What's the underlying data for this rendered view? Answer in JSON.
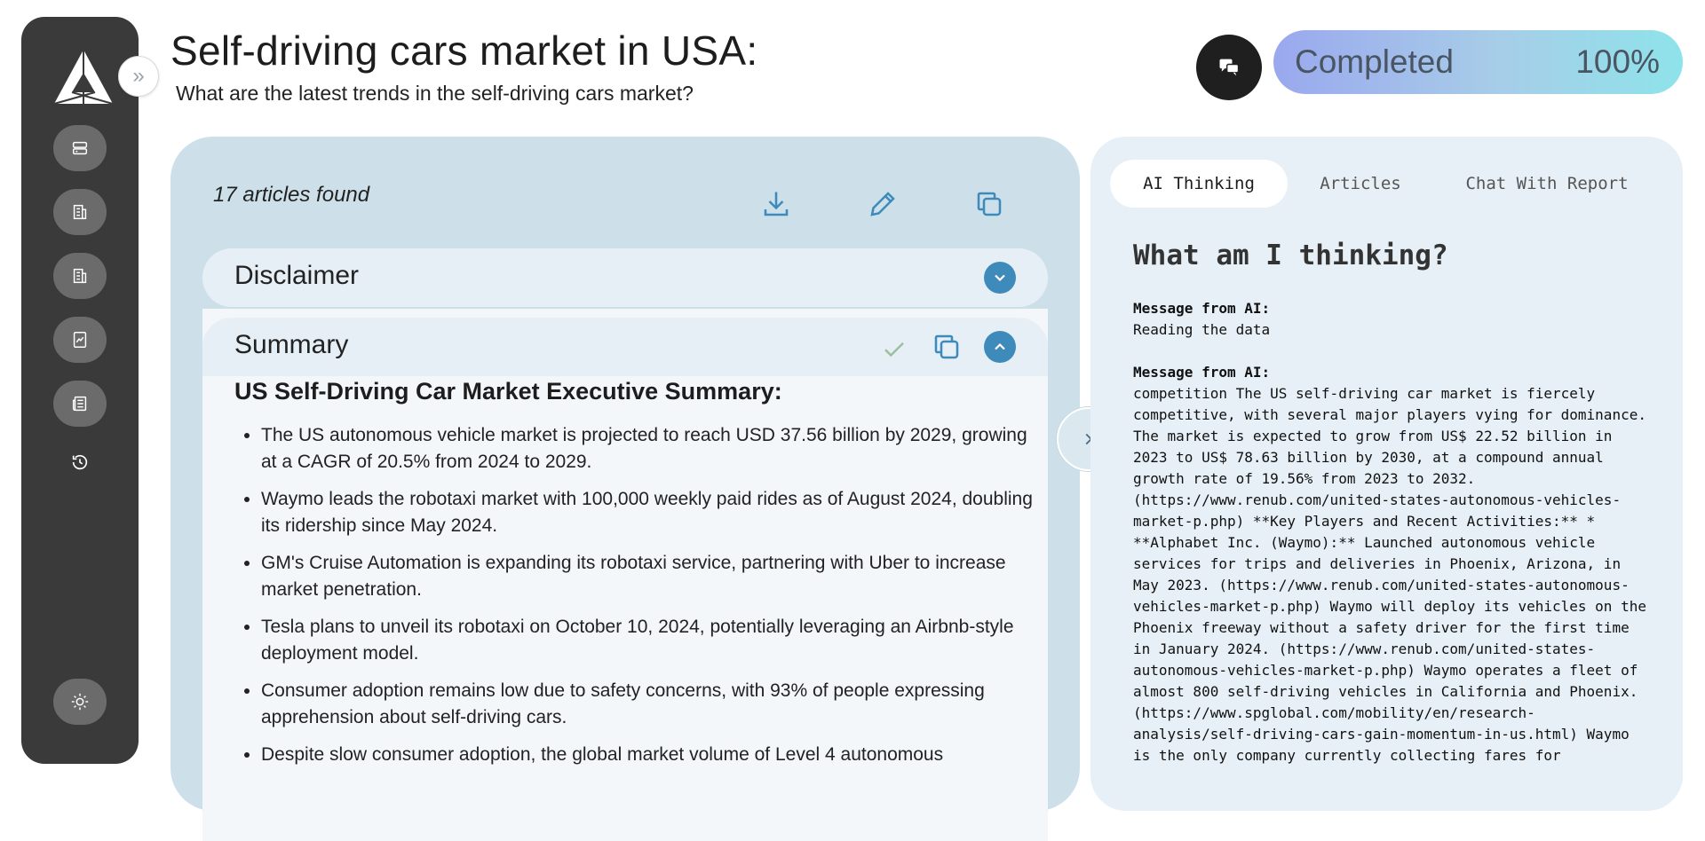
{
  "header": {
    "title": "Self-driving cars market in USA:",
    "subtitle": "What are the latest trends in the self-driving cars market?"
  },
  "status": {
    "label": "Completed",
    "percent": "100%",
    "progress": 1.0
  },
  "sidebar": {
    "items": [
      {
        "icon": "storage-icon"
      },
      {
        "icon": "building-icon"
      },
      {
        "icon": "building-icon"
      },
      {
        "icon": "chart-document-icon"
      },
      {
        "icon": "newspaper-icon"
      },
      {
        "icon": "history-icon"
      }
    ],
    "bottom_icon": "sun-icon"
  },
  "left_panel": {
    "articles_found": "17 articles found",
    "disclaimer_label": "Disclaimer",
    "summary_label": "Summary",
    "summary_heading": "US Self-Driving Car Market Executive Summary:",
    "bullets": [
      "The US autonomous vehicle market is projected to reach USD 37.56 billion by 2029, growing at a CAGR of 20.5% from 2024 to 2029.",
      "Waymo leads the robotaxi market with 100,000 weekly paid rides as of August 2024, doubling its ridership since May 2024.",
      "GM's Cruise Automation is expanding its robotaxi service, partnering with Uber to increase market penetration.",
      "Tesla plans to unveil its robotaxi on October 10, 2024, potentially leveraging an Airbnb-style deployment model.",
      "Consumer adoption remains low due to safety concerns, with 93% of people expressing apprehension about self-driving cars.",
      "Despite slow consumer adoption, the global market volume of Level 4 autonomous"
    ]
  },
  "right_panel": {
    "tabs": [
      {
        "label": "AI Thinking",
        "active": true
      },
      {
        "label": "Articles",
        "active": false
      },
      {
        "label": "Chat With Report",
        "active": false
      }
    ],
    "title": "What am I thinking?",
    "messages": [
      {
        "label": "Message from AI:",
        "text": "Reading the data"
      },
      {
        "label": "Message from AI:",
        "text": "competition The US self-driving car market is fiercely competitive, with several major players vying for dominance. The market is expected to grow from US$ 22.52 billion in 2023 to US$ 78.63 billion by 2030, at a compound annual growth rate of 19.56% from 2023 to 2032. (https://www.renub.com/united-states-autonomous-vehicles-market-p.php) **Key Players and Recent Activities:** * **Alphabet Inc. (Waymo):** Launched autonomous vehicle services for trips and deliveries in Phoenix, Arizona, in May 2023. (https://www.renub.com/united-states-autonomous-vehicles-market-p.php) Waymo will deploy its vehicles on the Phoenix freeway without a safety driver for the first time in January 2024. (https://www.renub.com/united-states-autonomous-vehicles-market-p.php) Waymo operates a fleet of almost 800 self-driving vehicles in California and Phoenix. (https://www.spglobal.com/mobility/en/research-analysis/self-driving-cars-gain-momentum-in-us.html) Waymo is the only company currently collecting fares for"
      }
    ]
  },
  "colors": {
    "sidebar_bg": "#3b3a3b",
    "accent_blue": "#3e8bbb",
    "left_panel_bg": "#cde0ea",
    "right_panel_bg": "#e6f0f6"
  }
}
